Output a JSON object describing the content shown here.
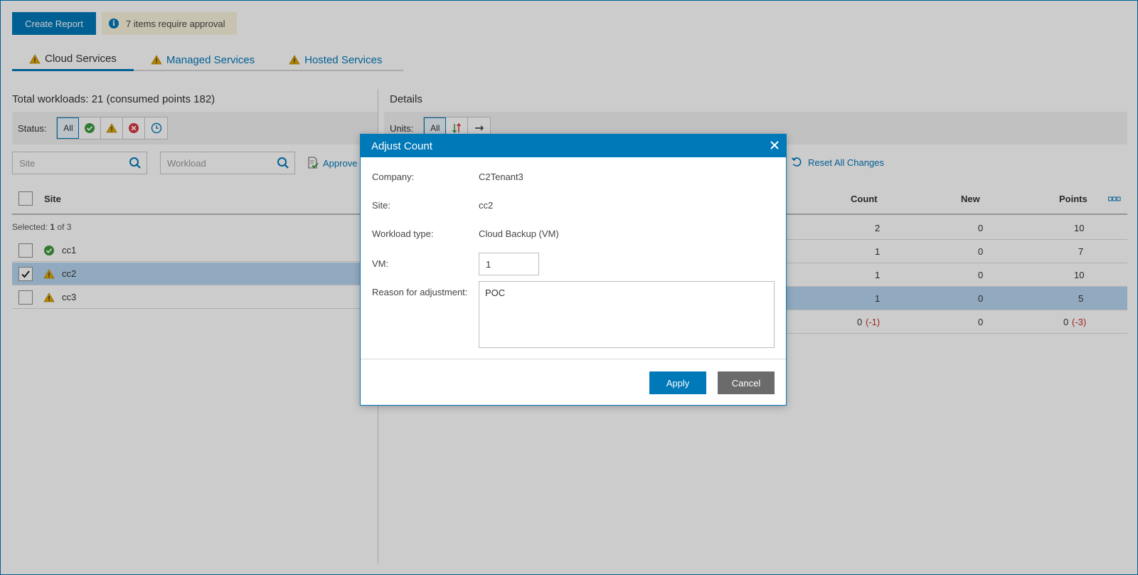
{
  "toolbar": {
    "create_report_label": "Create Report",
    "approval_notice": "7 items require approval",
    "info_icon": "i"
  },
  "tabs": [
    {
      "label": "Cloud Services",
      "icon": "warning-icon",
      "active": true
    },
    {
      "label": "Managed Services",
      "icon": "warning-icon",
      "active": false
    },
    {
      "label": "Hosted Services",
      "icon": "warning-icon",
      "active": false
    }
  ],
  "left": {
    "heading": "Total workloads: 21 (consumed points 182)",
    "status_label": "Status:",
    "status_filters": [
      "All",
      "success-icon",
      "warning-icon",
      "error-icon",
      "clock-icon"
    ],
    "site_placeholder": "Site",
    "workload_placeholder": "Workload",
    "approve_label": "Approve",
    "column_site": "Site",
    "selected_prefix": "Selected:",
    "selected_count": "1",
    "selected_suffix": "of 3",
    "sites": [
      {
        "name": "cc1",
        "status": "success-icon",
        "checked": false
      },
      {
        "name": "cc2",
        "status": "warning-icon",
        "checked": true
      },
      {
        "name": "cc3",
        "status": "warning-icon",
        "checked": false
      }
    ]
  },
  "right": {
    "heading": "Details",
    "units_label": "Units:",
    "units_filters": [
      "All",
      "up-down-arrows-icon",
      "right-arrow-icon"
    ],
    "reset_label": "Reset All Changes",
    "columns": {
      "count": "Count",
      "new": "New",
      "points": "Points"
    },
    "rows": [
      {
        "count": "2",
        "count_delta": "",
        "new": "0",
        "points": "10",
        "points_delta": ""
      },
      {
        "count": "1",
        "count_delta": "",
        "new": "0",
        "points": "7",
        "points_delta": ""
      },
      {
        "count": "1",
        "count_delta": "",
        "new": "0",
        "points": "10",
        "points_delta": ""
      },
      {
        "count": "1",
        "count_delta": "",
        "new": "0",
        "points": "5",
        "points_delta": ""
      },
      {
        "count": "0",
        "count_delta": "(-1)",
        "new": "0",
        "points": "0",
        "points_delta": "(-3)"
      }
    ]
  },
  "modal": {
    "title": "Adjust Count",
    "company_label": "Company:",
    "company_value": "C2Tenant3",
    "site_label": "Site:",
    "site_value": "cc2",
    "workload_label": "Workload type:",
    "workload_value": "Cloud Backup (VM)",
    "vm_label": "VM:",
    "vm_value": "1",
    "reason_label": "Reason for adjustment:",
    "reason_value": "POC",
    "apply_label": "Apply",
    "cancel_label": "Cancel"
  },
  "colors": {
    "accent": "#0079b8",
    "warning": "#e0a800",
    "success": "#3c9a3c",
    "error": "#d9363e",
    "selected_row": "#b7d5ef",
    "negative_delta": "#c9302c"
  }
}
